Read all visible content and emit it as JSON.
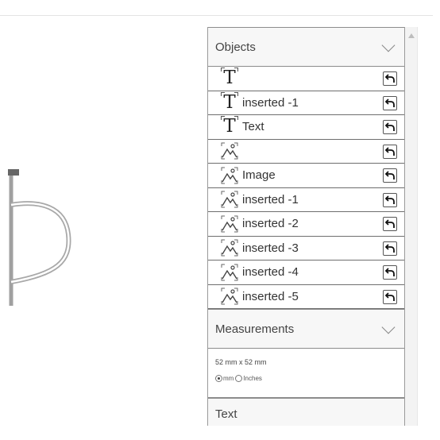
{
  "objects_panel": {
    "title": "Objects",
    "items": [
      {
        "type": "text",
        "icon": "text-frame-icon",
        "label": ""
      },
      {
        "type": "text",
        "icon": "text-frame-icon",
        "label": "inserted -1"
      },
      {
        "type": "text",
        "icon": "text-frame-icon",
        "label": "Text"
      },
      {
        "type": "image",
        "icon": "image-frame-icon",
        "label": ""
      },
      {
        "type": "image",
        "icon": "image-frame-icon",
        "label": "Image"
      },
      {
        "type": "image",
        "icon": "image-frame-icon",
        "label": "inserted -1"
      },
      {
        "type": "image",
        "icon": "image-frame-icon",
        "label": "inserted -2"
      },
      {
        "type": "image",
        "icon": "image-frame-icon",
        "label": "inserted -3"
      },
      {
        "type": "image",
        "icon": "image-frame-icon",
        "label": "inserted -4"
      },
      {
        "type": "image",
        "icon": "image-frame-icon",
        "label": "inserted -5"
      }
    ],
    "text_glyph": "T"
  },
  "measurements": {
    "title": "Measurements",
    "size": "52 mm x 52 mm",
    "unit_mm": "mm",
    "unit_inches": "Inches",
    "selected_unit": "mm"
  },
  "text_section": {
    "title": "Text"
  }
}
